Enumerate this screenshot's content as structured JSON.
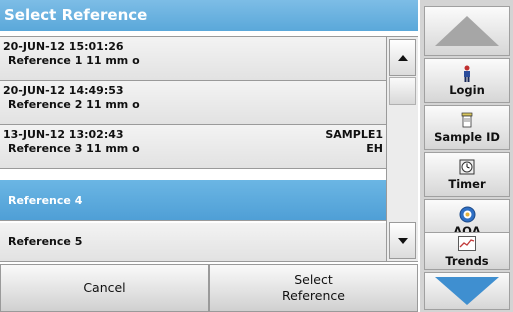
{
  "title": "Select Reference",
  "list": {
    "rows": [
      {
        "date": "20-JUN-12  15:01:26",
        "name": "Reference 1  11 mm o",
        "sample": "",
        "sample2": ""
      },
      {
        "date": "20-JUN-12  14:49:53",
        "name": "Reference 2  11 mm o",
        "sample": "",
        "sample2": ""
      },
      {
        "date": "13-JUN-12  13:02:43",
        "name": "Reference 3  11 mm o",
        "sample": "SAMPLE1",
        "sample2": "EH"
      },
      {
        "label": "Reference 4",
        "selected": true
      },
      {
        "label": "Reference 5",
        "selected": false
      }
    ]
  },
  "bottom": {
    "cancel_label": "Cancel",
    "select_line1": "Select",
    "select_line2": "Reference"
  },
  "side": {
    "login_label": "Login",
    "sample_id_label": "Sample ID",
    "timer_label": "Timer",
    "aqa_label": "AQA",
    "trends_label": "Trends"
  },
  "colors": {
    "accent": "#5aa8da",
    "arrow_up": "#a6a6a6",
    "arrow_down": "#3f8fd0"
  }
}
